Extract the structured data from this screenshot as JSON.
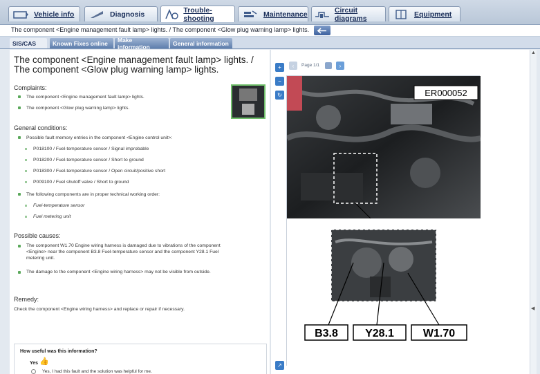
{
  "tabs": [
    {
      "label": "Vehicle info",
      "icon": "car-icon",
      "active": false
    },
    {
      "label": "Diagnosis",
      "icon": "stethoscope-icon",
      "active": false
    },
    {
      "label": "Trouble-shooting",
      "icon": "trouble-icon",
      "active": true
    },
    {
      "label": "Maintenance",
      "icon": "wrench-icon",
      "active": false
    },
    {
      "label": "Circuit diagrams",
      "icon": "circuit-icon",
      "active": false
    },
    {
      "label": "Equipment",
      "icon": "book-icon",
      "active": false
    }
  ],
  "breadcrumb": "The component <Engine management fault lamp> lights. / The component <Glow plug warning lamp> lights.",
  "subtabs": [
    "SIS/CAS",
    "Known Fixes online",
    "Make information",
    "General information"
  ],
  "title": "The component <Engine management fault lamp> lights. / The component <Glow plug warning lamp> lights.",
  "complaints": {
    "heading": "Complaints:",
    "items": [
      "The component <Engine management fault lamp> lights.",
      "The component <Glow plug warning lamp> lights."
    ]
  },
  "conditions": {
    "heading": "General conditions:",
    "intro": "Possible fault memory entries in the component <Engine control unit>:",
    "codes": [
      "P018100 / Fuel-temperature sensor / Signal improbable",
      "P018200 / Fuel-temperature sensor / Short to ground",
      "P018300 / Fuel-temperature sensor / Open circuit/positive short",
      "P009100 / Fuel shutoff valve / Short to ground"
    ],
    "intro2": "The following components are in proper technical working order:",
    "components": [
      "Fuel-temperature sensor",
      "Fuel metering unit"
    ]
  },
  "causes": {
    "heading": "Possible causes:",
    "items": [
      "The component W1.70 Engine wiring harness is damaged due to vibrations of the component <Engine> near the component B3.8 Fuel-temperature sensor and the component Y28.1 Fuel metering unit.",
      "The damage to the component <Engine wiring harness> may not be visible from outside."
    ]
  },
  "remedy": {
    "heading": "Remedy:",
    "text": "Check the component <Engine wiring harness> and replace or repair if necessary."
  },
  "feedback": {
    "question": "How useful was this information?",
    "yes_label": "Yes",
    "option": "Yes, I had this fault and the solution was helpful for me."
  },
  "viewer": {
    "page": "Page 1/1",
    "image_id": "ER000052",
    "callouts": [
      "B3.8",
      "Y28.1",
      "W1.70"
    ]
  },
  "colors": {
    "accent": "#3a7cc7",
    "tab_active": "#5e7ead",
    "bullet": "#5aa85a"
  }
}
